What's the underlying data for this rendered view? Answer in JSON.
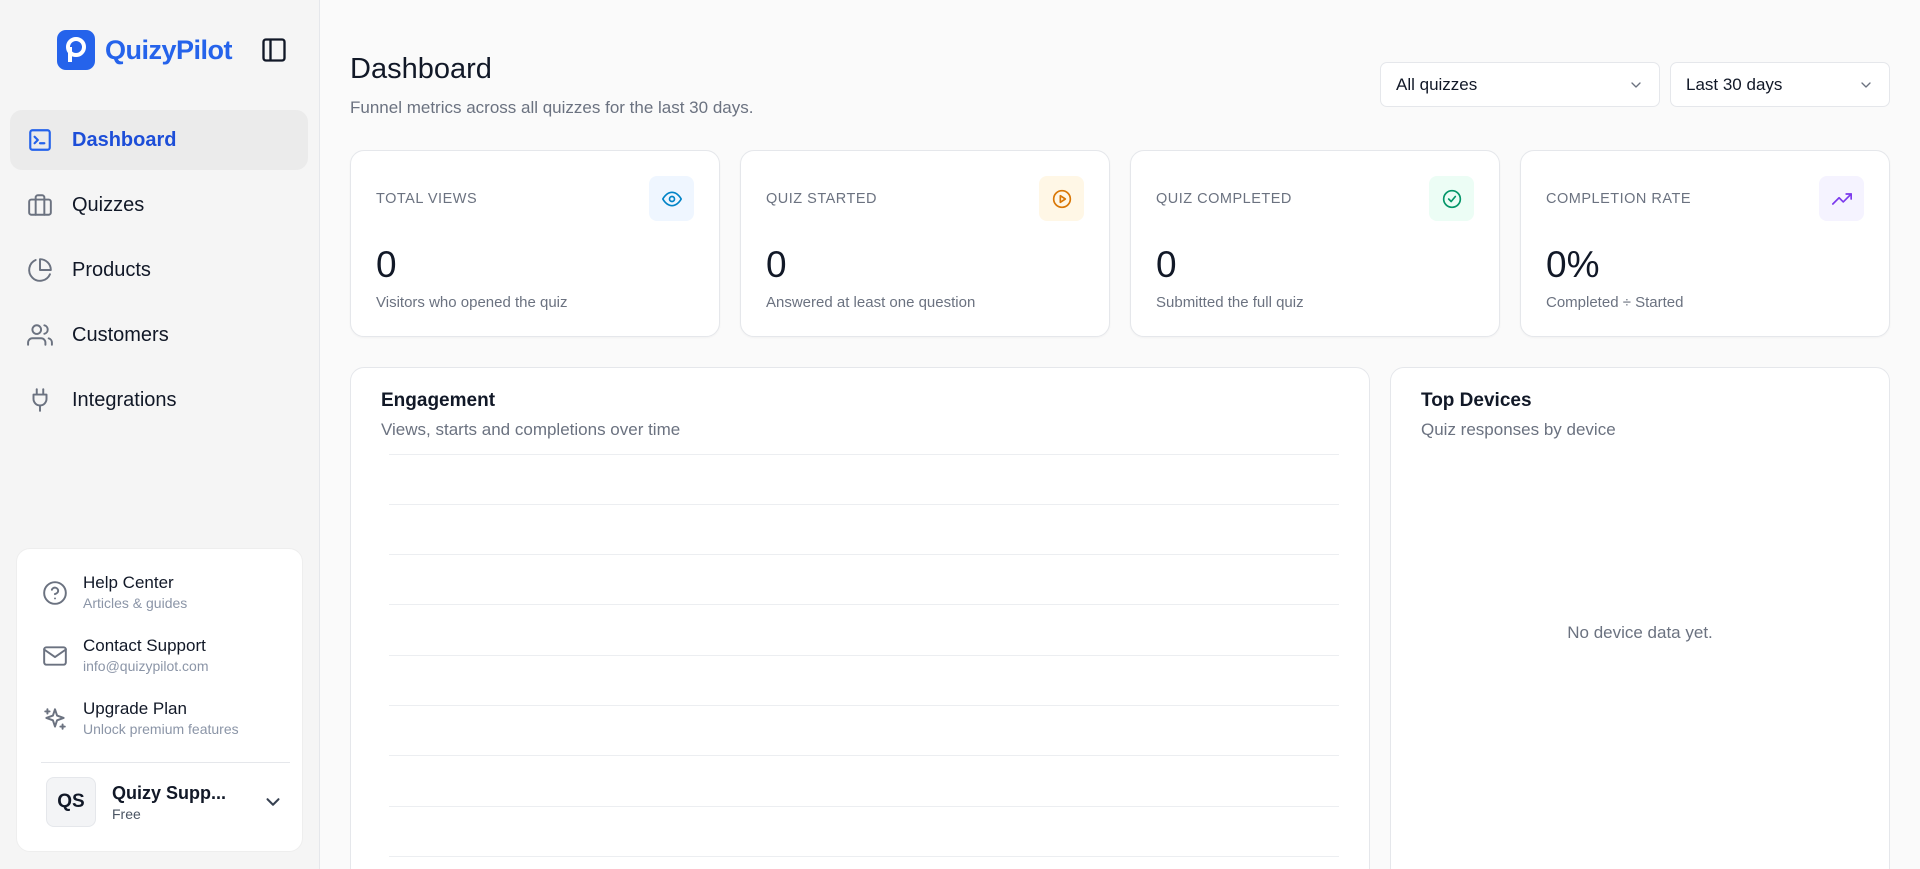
{
  "app": {
    "logo_text": "QuizyPilot",
    "brand_color": "#2563eb"
  },
  "sidebar": {
    "items": [
      {
        "label": "Dashboard",
        "icon": "terminal-square-icon",
        "active": true
      },
      {
        "label": "Quizzes",
        "icon": "briefcase-icon",
        "active": false
      },
      {
        "label": "Products",
        "icon": "pie-chart-icon",
        "active": false
      },
      {
        "label": "Customers",
        "icon": "users-icon",
        "active": false
      },
      {
        "label": "Integrations",
        "icon": "plug-icon",
        "active": false
      }
    ],
    "help": [
      {
        "title": "Help Center",
        "subtitle": "Articles & guides",
        "icon": "help-circle-icon"
      },
      {
        "title": "Contact Support",
        "subtitle": "info@quizypilot.com",
        "icon": "mail-icon"
      },
      {
        "title": "Upgrade Plan",
        "subtitle": "Unlock premium features",
        "icon": "sparkles-icon"
      }
    ],
    "user": {
      "initials": "QS",
      "name": "Quizy Supp...",
      "plan": "Free"
    }
  },
  "header": {
    "title": "Dashboard",
    "subtitle": "Funnel metrics across all quizzes for the last 30 days.",
    "quiz_filter": "All quizzes",
    "range_filter": "Last 30 days"
  },
  "stats": [
    {
      "label": "TOTAL VIEWS",
      "value": "0",
      "desc": "Visitors who opened the quiz",
      "icon": "eye-icon",
      "color": "#0284c7",
      "bg": "#eff6ff"
    },
    {
      "label": "QUIZ STARTED",
      "value": "0",
      "desc": "Answered at least one question",
      "icon": "play-circle-icon",
      "color": "#d97706",
      "bg": "#fff7e6"
    },
    {
      "label": "QUIZ COMPLETED",
      "value": "0",
      "desc": "Submitted the full quiz",
      "icon": "check-circle-icon",
      "color": "#059669",
      "bg": "#ecfdf5"
    },
    {
      "label": "COMPLETION RATE",
      "value": "0%",
      "desc": "Completed ÷ Started",
      "icon": "trending-up-icon",
      "color": "#7c3aed",
      "bg": "#f5f3ff"
    }
  ],
  "engagement": {
    "title": "Engagement",
    "subtitle": "Views, starts and completions over time"
  },
  "devices": {
    "title": "Top Devices",
    "subtitle": "Quiz responses by device",
    "empty": "No device data yet."
  }
}
